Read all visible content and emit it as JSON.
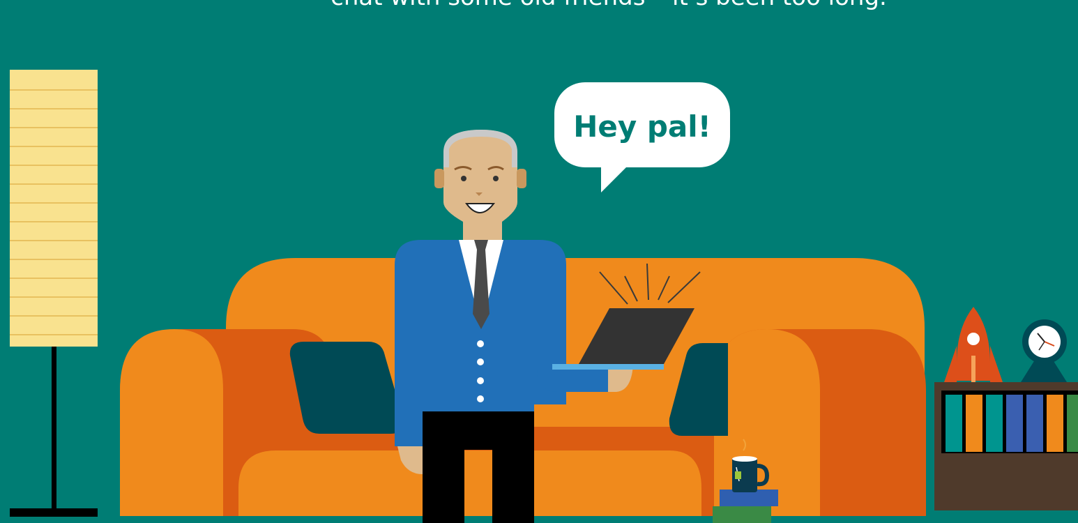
{
  "caption": {
    "text": "chat with some old friends – it’s been too long."
  },
  "speech_bubble": {
    "text": "Hey pal!"
  },
  "colors": {
    "background": "#007d74",
    "sofa_light": "#f08a1c",
    "sofa_dark": "#db5c12",
    "cushion": "#004a55",
    "jacket": "#2170b8",
    "skin": "#dfba8c",
    "lamp_shade": "#f9e28f",
    "laptop": "#333333",
    "bookshelf": "#4f3a2b",
    "mug": "#0b3b4f",
    "rocket": "#dd4f1a"
  },
  "icons": [
    "floor-lamp",
    "sofa",
    "man",
    "laptop",
    "speech-bubble",
    "mug",
    "books",
    "bookshelf",
    "rocket",
    "clock"
  ]
}
